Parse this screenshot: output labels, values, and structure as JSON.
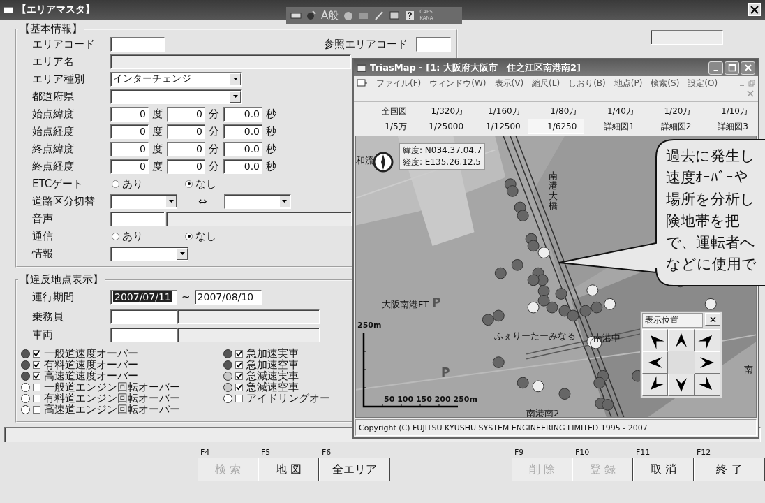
{
  "window": {
    "title": "【エリアマスタ】"
  },
  "ime_bar": {
    "mode": "A般",
    "caps": "CAPS",
    "kana": "KANA"
  },
  "basic_info": {
    "title": "【基本情報】",
    "rows": [
      {
        "kind": "code",
        "label": "エリアコード",
        "ref_label": "参照エリアコード"
      },
      {
        "kind": "wide",
        "label": "エリア名"
      },
      {
        "kind": "select",
        "label": "エリア種別",
        "value": "インターチェンジ"
      },
      {
        "kind": "select",
        "label": "都道府県"
      },
      {
        "kind": "dms",
        "label": "始点緯度",
        "values": [
          "0",
          "0",
          "0.0"
        ],
        "units": [
          "度",
          "分",
          "秒"
        ]
      },
      {
        "kind": "dms",
        "label": "始点経度",
        "values": [
          "0",
          "0",
          "0.0"
        ],
        "units": [
          "度",
          "分",
          "秒"
        ]
      },
      {
        "kind": "dms",
        "label": "終点緯度",
        "values": [
          "0",
          "0",
          "0.0"
        ],
        "units": [
          "度",
          "分",
          "秒"
        ]
      },
      {
        "kind": "dms",
        "label": "終点経度",
        "values": [
          "0",
          "0",
          "0.0"
        ],
        "units": [
          "度",
          "分",
          "秒"
        ]
      },
      {
        "kind": "radio",
        "label": "ETCゲート",
        "options": [
          {
            "label": "あり",
            "selected": false
          },
          {
            "label": "なし",
            "selected": true
          }
        ]
      },
      {
        "kind": "select_pair",
        "label": "道路区分切替",
        "separator": "⇔"
      },
      {
        "kind": "code_name",
        "label": "音声"
      },
      {
        "kind": "radio",
        "label": "通信",
        "options": [
          {
            "label": "あり",
            "selected": false
          },
          {
            "label": "なし",
            "selected": true
          }
        ]
      },
      {
        "kind": "select_short",
        "label": "情報"
      }
    ]
  },
  "violation": {
    "title": "【違反地点表示】",
    "period": {
      "label": "運行期間",
      "from": {
        "value": "2007/07/11",
        "selected": true
      },
      "separator": "~",
      "to": {
        "value": "2007/08/10",
        "selected": false
      }
    },
    "rows": [
      {
        "label": "乗務員"
      },
      {
        "label": "車両"
      }
    ],
    "legend": [
      {
        "label": "一般道速度オーバー",
        "checked": true,
        "color": "#555555"
      },
      {
        "label": "有料道速度オーバー",
        "checked": true,
        "color": "#555555"
      },
      {
        "label": "高速道速度オーバー",
        "checked": true,
        "color": "#555555"
      },
      {
        "label": "一般道エンジン回転オーバー",
        "checked": false,
        "color": "#ffffff"
      },
      {
        "label": "有料道エンジン回転オーバー",
        "checked": false,
        "color": "#ffffff"
      },
      {
        "label": "高速道エンジン回転オーバー",
        "checked": false,
        "color": "#ffffff"
      },
      {
        "label": "急加速実車",
        "checked": true,
        "color": "#555555"
      },
      {
        "label": "急加速空車",
        "checked": true,
        "color": "#555555"
      },
      {
        "label": "急減速実車",
        "checked": true,
        "color": "#c8c8c8"
      },
      {
        "label": "急減速空車",
        "checked": true,
        "color": "#c8c8c8"
      },
      {
        "label": "アイドリングオー",
        "checked": false,
        "color": "#ffffff"
      }
    ]
  },
  "function_keys": {
    "left": [
      {
        "key": "F4",
        "label": "検 索",
        "disabled": true
      },
      {
        "key": "F5",
        "label": "地 図",
        "disabled": false
      },
      {
        "key": "F6",
        "label": "全エリア",
        "disabled": false
      }
    ],
    "right": [
      {
        "key": "F9",
        "label": "削 除",
        "disabled": true
      },
      {
        "key": "F10",
        "label": "登 録",
        "disabled": true
      },
      {
        "key": "F11",
        "label": "取 消",
        "disabled": false
      },
      {
        "key": "F12",
        "label": "終 了",
        "disabled": false
      }
    ]
  },
  "map_window": {
    "title": "TriasMap - [1: 大阪府大阪市　住之江区南港南2]",
    "menu": [
      "ファイル(F)",
      "ウィンドウ(W)",
      "表示(V)",
      "縮尺(L)",
      "しおり(B)",
      "地点(P)",
      "検索(S)",
      "設定(O)"
    ],
    "scales": [
      {
        "label": "全国図",
        "selected": false
      },
      {
        "label": "1/320万",
        "selected": false
      },
      {
        "label": "1/160万",
        "selected": false
      },
      {
        "label": "1/80万",
        "selected": false
      },
      {
        "label": "1/40万",
        "selected": false
      },
      {
        "label": "1/20万",
        "selected": false
      },
      {
        "label": "1/10万",
        "selected": false
      },
      {
        "label": "1/5万",
        "selected": false
      },
      {
        "label": "1/25000",
        "selected": false
      },
      {
        "label": "1/12500",
        "selected": false
      },
      {
        "label": "1/6250",
        "selected": true
      },
      {
        "label": "詳細図1",
        "selected": false
      },
      {
        "label": "詳細図2",
        "selected": false
      },
      {
        "label": "詳細図3",
        "selected": false
      }
    ],
    "coords": [
      "緯度: N034.37.04.7",
      "経度: E135.26.12.5"
    ],
    "labels": [
      {
        "text": "和流",
        "kind": "place"
      },
      {
        "text": "南港大橋",
        "kind": "vertical"
      },
      {
        "text": "大阪南港FT",
        "kind": "place"
      },
      {
        "text": "ふぇりーたーみなる",
        "kind": "place"
      },
      {
        "text": "南港中",
        "kind": "place"
      },
      {
        "text": "南港南2",
        "kind": "place"
      },
      {
        "text": "南",
        "kind": "place"
      },
      {
        "text": "P",
        "kind": "parking"
      },
      {
        "text": "P",
        "kind": "parking"
      }
    ],
    "scale_bar": {
      "top": "250m",
      "ticks": "50 100 150 200 250m"
    },
    "nav_panel": {
      "title": "表示位置"
    },
    "status": "Copyright (C) FUJITSU KYUSHU SYSTEM ENGINEERING LIMITED 1995 - 2007"
  },
  "callout": {
    "lines": [
      "過去に発生し",
      "速度ｵｰﾊﾞｰや",
      "場所を分析し",
      "険地帯を把",
      "で、運転者へ",
      "などに使用で"
    ]
  }
}
